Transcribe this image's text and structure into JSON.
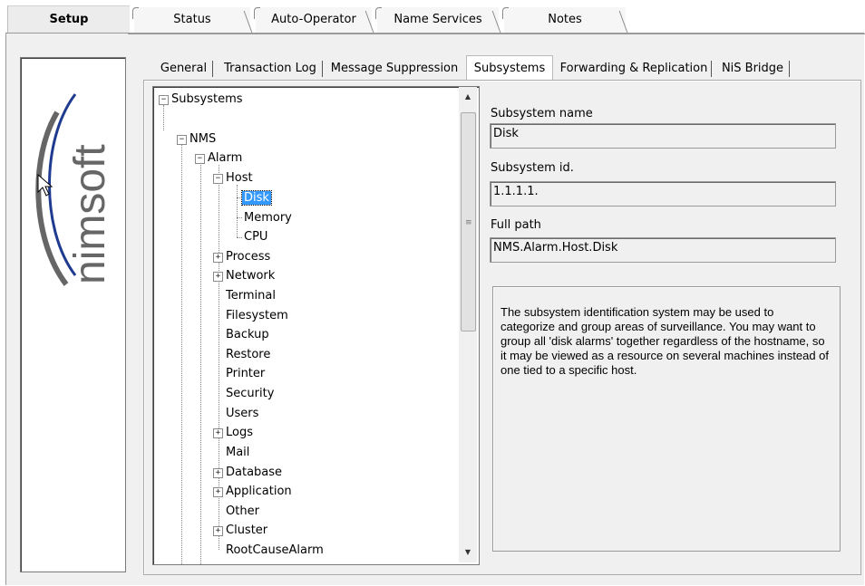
{
  "top_tabs": [
    {
      "label": "Setup"
    },
    {
      "label": "Status"
    },
    {
      "label": "Auto-Operator"
    },
    {
      "label": "Name Services"
    },
    {
      "label": "Notes"
    }
  ],
  "logo": {
    "text": "nimsoft"
  },
  "sub_tabs": [
    {
      "label": "General"
    },
    {
      "label": "Transaction Log"
    },
    {
      "label": "Message Suppression"
    },
    {
      "label": "Subsystems"
    },
    {
      "label": "Forwarding & Replication"
    },
    {
      "label": "NiS Bridge"
    }
  ],
  "tree": {
    "nodes": [
      {
        "label": "Subsystems",
        "expander": "−"
      },
      {
        "label": "NMS",
        "expander": "−"
      },
      {
        "label": "Alarm",
        "expander": "−"
      },
      {
        "label": "Host",
        "expander": "−"
      },
      {
        "label": "Disk",
        "selected": true
      },
      {
        "label": "Memory"
      },
      {
        "label": "CPU"
      },
      {
        "label": "Process",
        "expander": "+"
      },
      {
        "label": "Network",
        "expander": "+"
      },
      {
        "label": "Terminal"
      },
      {
        "label": "Filesystem"
      },
      {
        "label": "Backup"
      },
      {
        "label": "Restore"
      },
      {
        "label": "Printer"
      },
      {
        "label": "Security"
      },
      {
        "label": "Users"
      },
      {
        "label": "Logs",
        "expander": "+"
      },
      {
        "label": "Mail"
      },
      {
        "label": "Database",
        "expander": "+"
      },
      {
        "label": "Application",
        "expander": "+"
      },
      {
        "label": "Other"
      },
      {
        "label": "Cluster",
        "expander": "+"
      },
      {
        "label": "RootCauseAlarm"
      }
    ]
  },
  "details": {
    "name_label": "Subsystem name",
    "name_value": "Disk",
    "id_label": "Subsystem id.",
    "id_value": "1.1.1.1.",
    "path_label": "Full path",
    "path_value": "NMS.Alarm.Host.Disk",
    "description": "The subsystem identification system may be used to categorize and group areas of surveillance.  You may want to group all 'disk alarms' together regardless of the hostname, so it may be viewed as a resource on several machines instead of one tied to a specific host."
  },
  "colors": {
    "selection": "#3399ff",
    "logo_gray": "#666666",
    "logo_blue": "#1f3b8f"
  }
}
